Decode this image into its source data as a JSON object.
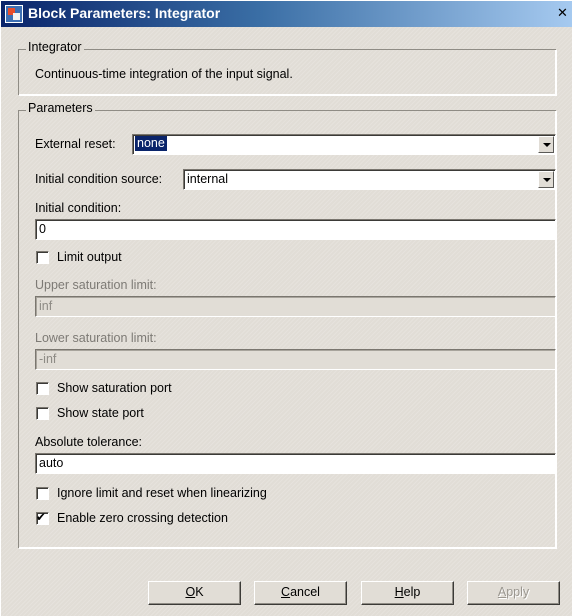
{
  "window": {
    "title": "Block Parameters: Integrator",
    "close_glyph": "✕"
  },
  "integrator_group": {
    "legend": "Integrator",
    "description": "Continuous-time integration of the input signal."
  },
  "parameters_group": {
    "legend": "Parameters",
    "external_reset": {
      "label": "External reset:",
      "value": "none"
    },
    "initial_condition_source": {
      "label": "Initial condition source:",
      "value": "internal"
    },
    "initial_condition": {
      "label": "Initial condition:",
      "value": "0"
    },
    "limit_output": {
      "label": "Limit output",
      "checked": false
    },
    "upper_saturation_limit": {
      "label": "Upper saturation limit:",
      "value": "inf",
      "enabled": false
    },
    "lower_saturation_limit": {
      "label": "Lower saturation limit:",
      "value": "-inf",
      "enabled": false
    },
    "show_saturation_port": {
      "label": "Show saturation port",
      "checked": false
    },
    "show_state_port": {
      "label": "Show state port",
      "checked": false
    },
    "absolute_tolerance": {
      "label": "Absolute tolerance:",
      "value": "auto"
    },
    "ignore_limit_reset": {
      "label": "Ignore limit and reset when linearizing",
      "checked": false
    },
    "enable_zero_crossing": {
      "label": "Enable zero crossing detection",
      "checked": true
    }
  },
  "buttons": {
    "ok": {
      "mnemonic": "O",
      "rest": "K"
    },
    "cancel": {
      "mnemonic": "C",
      "rest": "ancel"
    },
    "help": {
      "mnemonic": "H",
      "rest": "elp"
    },
    "apply": {
      "mnemonic": "A",
      "rest": "pply",
      "enabled": false
    }
  },
  "colors": {
    "titlebar_start": "#0a246a",
    "titlebar_end": "#a6caf0",
    "dialog_face": "#e1ddd6",
    "selection": "#0a246a"
  }
}
